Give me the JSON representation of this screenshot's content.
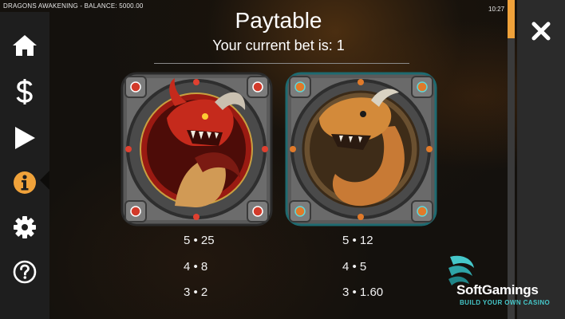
{
  "window": {
    "title": "DRAGONS AWAKENING - BALANCE: 5000.00",
    "clock": "10:27"
  },
  "sidebar": {
    "items": [
      {
        "icon": "home-icon"
      },
      {
        "icon": "dollar-icon"
      },
      {
        "icon": "play-icon"
      },
      {
        "icon": "info-icon",
        "active": true
      },
      {
        "icon": "gear-icon"
      },
      {
        "icon": "help-icon"
      }
    ]
  },
  "close": {
    "icon": "close-icon"
  },
  "paytable": {
    "title": "Paytable",
    "bet_line": "Your current bet is: 1",
    "symbols": [
      {
        "name": "red-dragon",
        "payouts": [
          "5 • 25",
          "4 • 8",
          "3 • 2"
        ]
      },
      {
        "name": "orange-dragon",
        "payouts": [
          "5 • 12",
          "4 • 5",
          "3 • 1.60"
        ]
      }
    ]
  },
  "logo": {
    "name": "SoftGamings",
    "tagline": "BUILD YOUR OWN CASINO"
  },
  "colors": {
    "accent": "#f0a23a",
    "sidebar": "#1e1e1e",
    "logo_teal": "#45c7c9"
  }
}
